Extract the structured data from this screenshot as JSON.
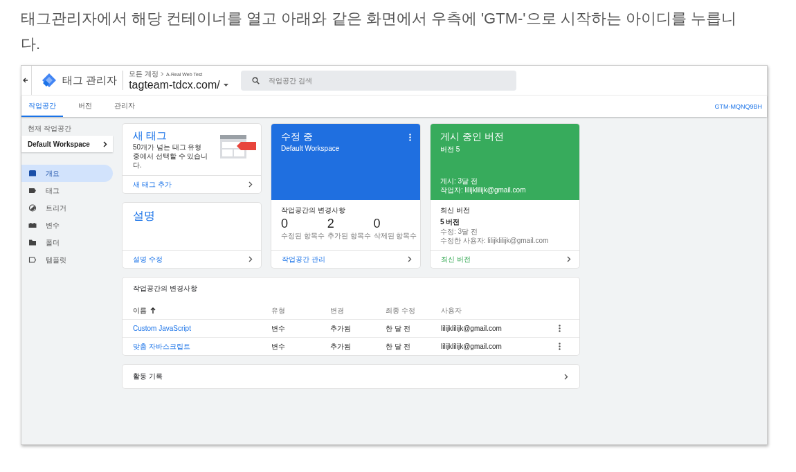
{
  "intro": "태그관리자에서 해당 컨테이너를 열고 아래와 같은 화면에서 우측에 'GTM-'으로 시작하는 아이디를 누릅니다.",
  "header": {
    "product": "태그 관리자",
    "breadcrumb": [
      "모든 계정",
      "A-Real Web Test"
    ],
    "container": "tagteam-tdcx.com/",
    "search": {
      "placeholder": "작업공간 검색"
    }
  },
  "tabs": [
    {
      "label": "작업공간",
      "selected": true
    },
    {
      "label": "버전",
      "selected": false
    },
    {
      "label": "관리자",
      "selected": false
    }
  ],
  "container_id": "GTM-MQNQ9BH",
  "sidebar": {
    "workspace_label": "현재 작업공간",
    "workspace_name": "Default Workspace",
    "items": [
      {
        "label": "개요",
        "selected": true
      },
      {
        "label": "태그",
        "selected": false
      },
      {
        "label": "트리거",
        "selected": false
      },
      {
        "label": "변수",
        "selected": false
      },
      {
        "label": "폴더",
        "selected": false
      },
      {
        "label": "템플릿",
        "selected": false
      }
    ]
  },
  "new_tag": {
    "title": "새 태그",
    "text": "50개가 넘는 태그 유형 중에서 선택할 수 있습니다.",
    "link": "새 태그 추가"
  },
  "description": {
    "title": "설명",
    "link": "설명 수정"
  },
  "editing": {
    "title": "수정 중",
    "subtitle": "Default Workspace",
    "changes_title": "작업공간의 변경사항",
    "counts": [
      {
        "value": "0",
        "label": "수정된 항목수"
      },
      {
        "value": "2",
        "label": "추가된 항목수"
      },
      {
        "value": "0",
        "label": "삭제된 항목수"
      }
    ],
    "link": "작업공간 관리"
  },
  "published": {
    "title": "게시 중인 버전",
    "subtitle": "버전 5",
    "published": "게시: 3달 전",
    "author": "작업자: lilijklilijk@gmail.com",
    "latest_title": "최신 버전",
    "latest_version": "5 버전",
    "modified": "수정: 3달 전",
    "modified_by": "수정한 사용자: lilijklilijk@gmail.com",
    "link": "최신 버전"
  },
  "table": {
    "title": "작업공간의 변경사항",
    "columns": [
      "이름",
      "유형",
      "변경",
      "최종 수정",
      "사용자"
    ],
    "rows": [
      [
        "Custom JavaScript",
        "변수",
        "추가됨",
        "한 달 전",
        "lilijklilijk@gmail.com"
      ],
      [
        "맞춤 자바스크립트",
        "변수",
        "추가됨",
        "한 달 전",
        "lilijklilijk@gmail.com"
      ]
    ]
  },
  "activity": {
    "title": "활동 기록"
  }
}
